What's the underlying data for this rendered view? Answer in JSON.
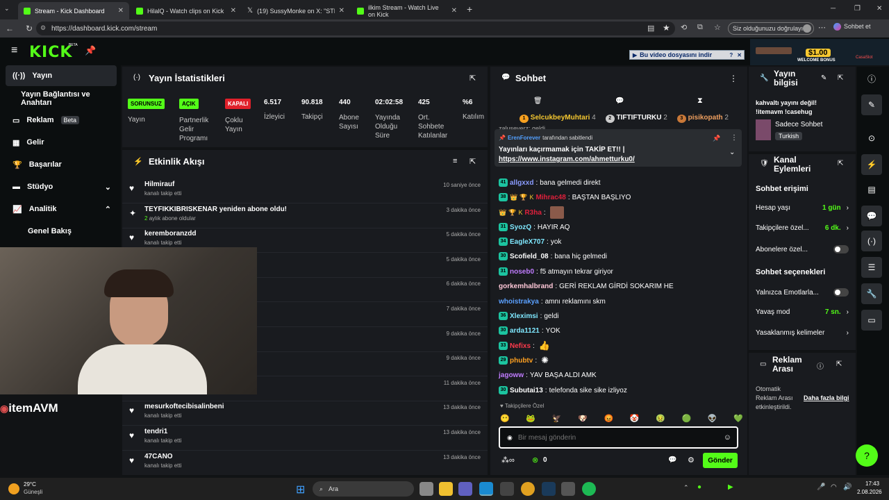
{
  "tabs": [
    {
      "label": "Stream - Kick Dashboard",
      "active": true
    },
    {
      "label": "HilalQ - Watch clips on Kick"
    },
    {
      "label": "(19) SussyMonke on X: \"STEAM YE"
    },
    {
      "label": "ilkim Stream - Watch Live on Kick"
    }
  ],
  "url": "https://dashboard.kick.com/stream",
  "verify_label": "Siz olduğunuzu doğrulayın",
  "sohbet_ext": "Sohbet et",
  "download_bar": "Bu video dosyasını indir",
  "ad": {
    "amount": "$1.00",
    "text": "WELCOME BONUS",
    "brand": "CasaSlot"
  },
  "logo": "KICK",
  "logo_badge": "BETA",
  "sidebar": {
    "items": [
      {
        "label": "Yayın",
        "active": true
      },
      {
        "label": "Yayın Bağlantısı ve Anahtarı"
      },
      {
        "label": "Reklam",
        "badge": "Beta"
      },
      {
        "label": "Gelir"
      },
      {
        "label": "Başarılar"
      },
      {
        "label": "Stüdyo"
      },
      {
        "label": "Analitik"
      },
      {
        "label": "Genel Bakış"
      }
    ]
  },
  "stats": {
    "title": "Yayın İstatistikleri",
    "cols": [
      {
        "pill": "SORUNSUZ",
        "pill_color": "#53fc18",
        "label": "Yayın"
      },
      {
        "pill": "AÇIK",
        "pill_color": "#53fc18",
        "label": "Partnerlik Gelir Programı"
      },
      {
        "pill": "KAPALI",
        "pill_color": "#e0202a",
        "label": "Çoklu Yayın"
      },
      {
        "value": "6.517",
        "label": "İzleyici"
      },
      {
        "value": "90.818",
        "label": "Takipçi"
      },
      {
        "value": "440",
        "label": "Abone Sayısı"
      },
      {
        "value": "02:02:58",
        "label": "Yayında Olduğu Süre"
      },
      {
        "value": "425",
        "label": "Ort. Sohbete Katılanlar"
      },
      {
        "value": "%6",
        "label": "Katılım"
      }
    ]
  },
  "activity": {
    "title": "Etkinlik Akışı",
    "items": [
      {
        "name": "Hilmirauf",
        "sub": "kanalı takip etti",
        "time": "10 saniye önce",
        "icon": "heart"
      },
      {
        "name": "TEYFIKKIBRISKENAR yeniden abone oldu!",
        "sub": "aylık abone oldular",
        "sub_num": "2",
        "time": "3 dakika önce",
        "icon": "star"
      },
      {
        "name": "keremboranzdd",
        "sub": "kanalı takip etti",
        "time": "5 dakika önce",
        "icon": "heart"
      },
      {
        "name": "",
        "sub": "",
        "time": "5 dakika önce",
        "icon": "heart"
      },
      {
        "name": "",
        "sub": "",
        "time": "6 dakika önce",
        "icon": "heart"
      },
      {
        "name": "",
        "sub": "",
        "time": "7 dakika önce",
        "icon": "heart"
      },
      {
        "name": "",
        "sub": "",
        "time": "9 dakika önce",
        "icon": "heart"
      },
      {
        "name": "",
        "sub": "",
        "time": "9 dakika önce",
        "icon": "heart"
      },
      {
        "name": "",
        "sub": "",
        "time": "11 dakika önce",
        "icon": "heart"
      },
      {
        "name": "mesurkoftecibisalinbeni",
        "sub": "kanalı takip etti",
        "time": "13 dakika önce",
        "icon": "heart"
      },
      {
        "name": "tendri1",
        "sub": "kanalı takip etti",
        "time": "13 dakika önce",
        "icon": "heart"
      },
      {
        "name": "47CANO",
        "sub": "kanalı takip etti",
        "time": "13 dakika önce",
        "icon": "heart"
      }
    ]
  },
  "overlay_brand": "itemAVM",
  "chat": {
    "title": "Sohbet",
    "top": [
      {
        "rank": "1",
        "name": "SelcukbeyMuhtari",
        "count": "4"
      },
      {
        "rank": "2",
        "name": "TIFTIFTURKU",
        "count": "2"
      },
      {
        "rank": "3",
        "name": "pisikopath",
        "count": "2"
      }
    ],
    "pinned": {
      "by": "ErenForever",
      "by_suffix": "tarafından sabitlendi",
      "text": "Yayınları kaçırmamak için TAKİP ET!! |",
      "link": "https://www.instagram.com/ahmetturku0/"
    },
    "partial": "zaluseverz: geldi",
    "messages": [
      {
        "badge": "41",
        "user": "allgxxd",
        "color": "#8a9cff",
        "text": "bana gelmedi direkt"
      },
      {
        "badge": "38",
        "user": "Mihrac48",
        "color": "#e0203c",
        "text": "BAŞTAN BAŞLIYO"
      },
      {
        "badge": "",
        "user": "R3ha",
        "color": "#e0203c",
        "text": ""
      },
      {
        "badge": "31",
        "user": "SyozQ",
        "color": "#7fe8ff",
        "text": "HAYIR AQ"
      },
      {
        "badge": "34",
        "user": "EagleX707",
        "color": "#7fe8ff",
        "text": "yok"
      },
      {
        "badge": "30",
        "user": "Scofield_08",
        "color": "#ffffff",
        "text": "bana hiç gelmedi"
      },
      {
        "badge": "31",
        "user": "noseb0",
        "color": "#c07cff",
        "text": "f5 atmayın tekrar giriyor"
      },
      {
        "badge": "",
        "user": "gorkemhalbrand",
        "color": "#ffc8d8",
        "text": "GERİ REKLAM GİRDİ SOKARIM HE"
      },
      {
        "badge": "",
        "user": "whoistrakya",
        "color": "#5aa0ff",
        "text": "amnı reklamını skm"
      },
      {
        "badge": "36",
        "user": "Xleximsi",
        "color": "#7fe8ff",
        "text": "geldi"
      },
      {
        "badge": "30",
        "user": "arda1121",
        "color": "#7fe8ff",
        "text": "YOK"
      },
      {
        "badge": "33",
        "user": "Nefixs",
        "color": "#ff3a4c",
        "text": ""
      },
      {
        "badge": "29",
        "user": "phubtv",
        "color": "#ffa020",
        "text": ""
      },
      {
        "badge": "",
        "user": "jagoww",
        "color": "#c07cff",
        "text": "YAV BAŞA ALDI AMK"
      },
      {
        "badge": "30",
        "user": "Subutai13",
        "color": "#ffffff",
        "text": "telefonda sike sike izliyoz"
      }
    ],
    "followers_only": "Takipçilere Özel",
    "placeholder": "Bir mesaj gönderin",
    "points": "0",
    "send": "Gönder"
  },
  "stream_info": {
    "title": "Yayın bilgisi",
    "desc": "kahvaltı yayını değil! !itemavm !casehug",
    "category": "Sadece Sohbet",
    "language": "Turkish"
  },
  "channel_actions": {
    "title": "Kanal Eylemleri",
    "chat_access": "Sohbet erişimi",
    "rows": [
      {
        "label": "Hesap yaşı",
        "value": "1 gün",
        "type": "value"
      },
      {
        "label": "Takipçilere özel...",
        "value": "6 dk.",
        "type": "value"
      },
      {
        "label": "Abonelere özel...",
        "type": "toggle"
      }
    ],
    "chat_options": "Sohbet seçenekleri",
    "rows2": [
      {
        "label": "Yalnızca Emotlarla...",
        "type": "toggle"
      },
      {
        "label": "Yavaş mod",
        "value": "7 sn.",
        "type": "value"
      },
      {
        "label": "Yasaklanmış kelimeler",
        "type": "chevron"
      }
    ]
  },
  "ad_break": {
    "title": "Reklam Arası",
    "desc": "Otomatik Reklam Arası etkinleştirildi.",
    "link": "Daha fazla bilgi"
  },
  "taskbar": {
    "weather_temp": "29°C",
    "weather_desc": "Güneşli",
    "search": "Ara",
    "time": "17:43",
    "date": "2.08.2026"
  }
}
